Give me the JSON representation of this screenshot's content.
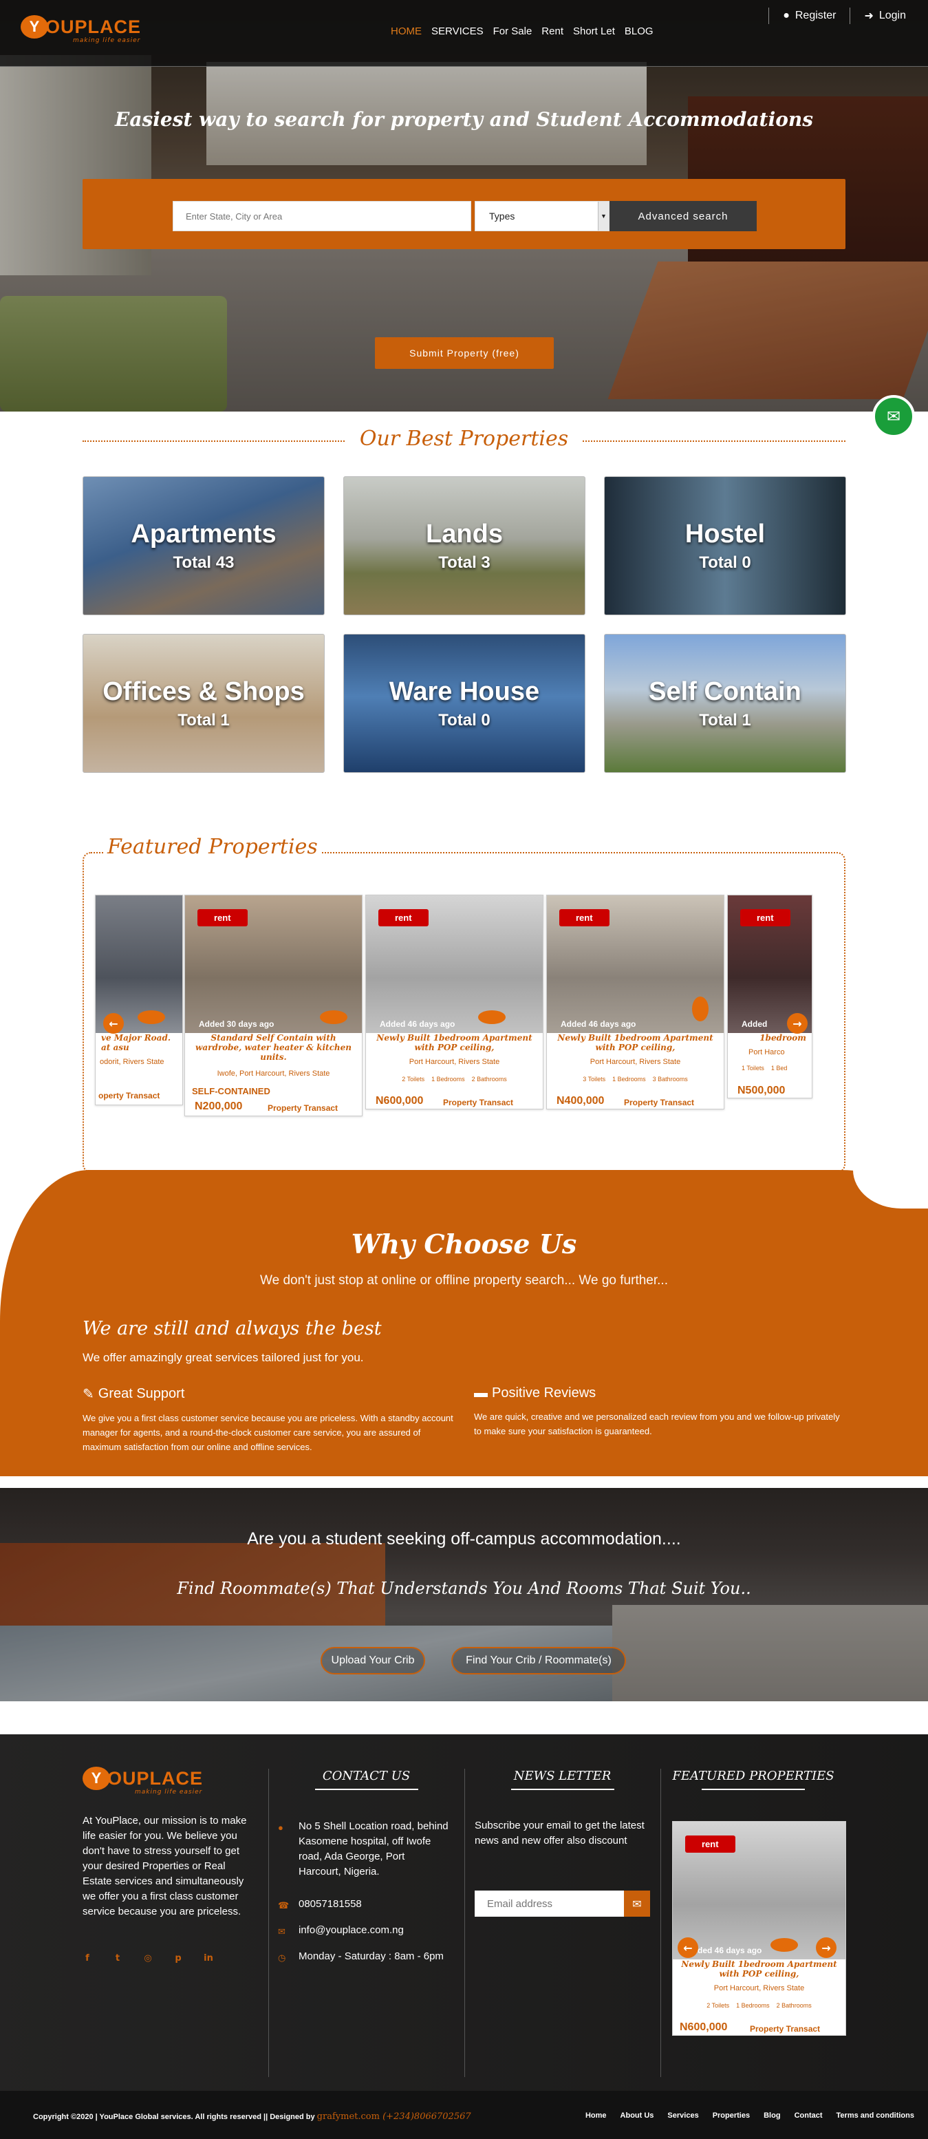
{
  "header": {
    "logo_letter": "Y",
    "logo_word": "OUPLACE",
    "logo_tagline": "making life easier",
    "nav": [
      {
        "label": "HOME",
        "active": true
      },
      {
        "label": "SERVICES"
      },
      {
        "label": "For Sale"
      },
      {
        "label": "Rent"
      },
      {
        "label": "Short Let"
      },
      {
        "label": "BLOG"
      }
    ],
    "register_label": "Register",
    "login_label": "Login",
    "register_icon": "user-circle-icon",
    "login_icon": "sign-in-icon"
  },
  "hero": {
    "title": "Easiest way to search for property and Student Accommodations",
    "search_placeholder": "Enter State, City or Area",
    "types_selected": "Types",
    "advanced_label": "Advanced search",
    "submit_label": "Submit Property (free)"
  },
  "best": {
    "title": "Our Best Properties",
    "categories": [
      {
        "name": "Apartments",
        "total": "Total 43"
      },
      {
        "name": "Lands",
        "total": "Total 3"
      },
      {
        "name": "Hostel",
        "total": "Total 0"
      },
      {
        "name": "Offices & Shops",
        "total": "Total 1"
      },
      {
        "name": "Ware House",
        "total": "Total 0"
      },
      {
        "name": "Self Contain",
        "total": "Total 1"
      }
    ]
  },
  "featured": {
    "title": "Featured Properties",
    "cards": [
      {
        "title": "ve Major Road. at\nasu",
        "location": "odorit, Rivers State",
        "agent": "operty Transact"
      },
      {
        "badge": "rent",
        "added": "Added 30 days ago",
        "title": "Standard Self Contain with wardrobe, water heater & kitchen units.",
        "location": "Iwofe, Port Harcourt, Rivers State",
        "type": "SELF-CONTAINED",
        "price": "N200,000",
        "agent": "Property Transact"
      },
      {
        "badge": "rent",
        "added": "Added 46 days ago",
        "title": "Newly Built 1bedroom Apartment with POP ceiling,",
        "location": "Port Harcourt, Rivers State",
        "toilets": "2 Toilets",
        "bedrooms": "1 Bedrooms",
        "bathrooms": "2 Bathrooms",
        "price": "N600,000",
        "agent": "Property Transact"
      },
      {
        "badge": "rent",
        "added": "Added 46 days ago",
        "title": "Newly Built 1bedroom Apartment with POP ceiling,",
        "location": "Port Harcourt, Rivers State",
        "toilets": "3 Toilets",
        "bedrooms": "1 Bedrooms",
        "bathrooms": "3 Bathrooms",
        "price": "N400,000",
        "agent": "Property Transact"
      },
      {
        "badge": "rent",
        "added": "Added",
        "added2": "ay",
        "title": "1bedroom",
        "location": "Port Harco",
        "toilets": "1 Toilets",
        "bedrooms": "1 Bed",
        "price": "N500,000"
      }
    ]
  },
  "why": {
    "title": "Why Choose Us",
    "subtitle": "We don't just stop at online or offline property search... We go further...",
    "h3": "We are still and always the best",
    "p": "We offer amazingly great services tailored just for you.",
    "support_title": "Great Support",
    "support_text": "We give you a first class customer service because you are priceless. With a standby account manager for agents, and a round-the-clock customer care service, you are assured of maximum satisfaction from our online and offline services.",
    "reviews_title": "Positive Reviews",
    "reviews_text": "We are quick, creative and we personalized each review from you and we follow-up privately to make sure your satisfaction is guaranteed."
  },
  "student": {
    "question": "Are you a student seeking off-campus accommodation....",
    "find": "Find Roommate(s) That Understands You And Rooms That Suit You..",
    "upload_label": "Upload Your Crib",
    "find_label": "Find Your Crib / Roommate(s)"
  },
  "footer": {
    "about": "At YouPlace, our mission is to make life easier for you. We believe you don't have to stress yourself to get your desired Properties or Real Estate services and simultaneously we offer you a first class customer service because you are priceless.",
    "contact_title": "CONTACT US",
    "address": "No 5 Shell Location road, behind Kasomene hospital, off Iwofe road, Ada George, Port Harcourt, Nigeria.",
    "phone": "08057181558",
    "email": "info@youplace.com.ng",
    "hours": "Monday - Saturday : 8am - 6pm",
    "news_title": "NEWS LETTER",
    "news_text": "Subscribe your email to get the latest news and new offer also discount",
    "email_placeholder": "Email address",
    "featured_title": "FEATURED PROPERTIES",
    "fcard": {
      "badge": "rent",
      "added": "Added 46 days ago",
      "title": "Newly Built 1bedroom Apartment with POP ceiling,",
      "location": "Port Harcourt, Rivers State",
      "toilets": "2 Toilets",
      "bedrooms": "1 Bedrooms",
      "bathrooms": "2 Bathrooms",
      "price": "N600,000",
      "agent": "Property Transact"
    }
  },
  "bottom": {
    "copyright": "Copyright ©2020 | YouPlace Global services. All rights reserved || Designed by ",
    "designer": "grafymet.com",
    "designer_phone": " (+234)8066702567",
    "links": [
      "Home",
      "About Us",
      "Services",
      "Properties",
      "Blog",
      "Contact",
      "Terms and conditions"
    ]
  },
  "colors": {
    "accent": "#c85f0a",
    "badge": "#cc0000",
    "fab": "#1a9e3a"
  }
}
